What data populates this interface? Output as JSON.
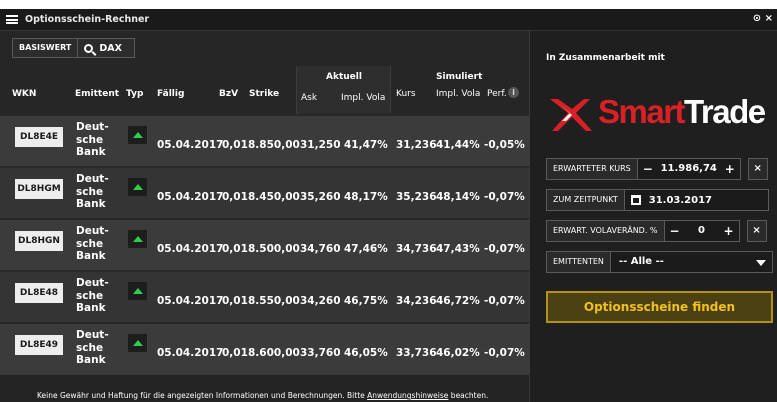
{
  "window": {
    "title": "Optionsschein-Rechner",
    "controls": "⊙ ×"
  },
  "search": {
    "basiswert_label": "BASISWERT",
    "underlying": "DAX"
  },
  "table": {
    "headers": {
      "wkn": "WKN",
      "emittent": "Emittent",
      "typ": "Typ",
      "faellig": "Fällig",
      "bzv": "BzV",
      "strike": "Strike",
      "aktuell": "Aktuell",
      "ask": "Ask",
      "impl_vola_aktuell": "Impl. Vola",
      "simuliert": "Simuliert",
      "kurs": "Kurs",
      "impl_vola_sim": "Impl. Vola",
      "perf": "Perf.",
      "info": "i"
    },
    "rows": [
      {
        "wkn": "DL8E4E",
        "emittent_lines": [
          "Deut-",
          "sche",
          "Bank"
        ],
        "typ": "call-up-icon",
        "faellig": "05.04.2017",
        "bzv": "0,01",
        "strike": "8.850,00",
        "ask": "31,250",
        "impl_vola": "41,47%",
        "kurs": "31,236",
        "impl_vola_sim": "41,44%",
        "perf": "-0,05%"
      },
      {
        "wkn": "DL8HGM",
        "emittent_lines": [
          "Deut-",
          "sche",
          "Bank"
        ],
        "typ": "call-up-icon",
        "faellig": "05.04.2017",
        "bzv": "0,01",
        "strike": "8.450,00",
        "ask": "35,260",
        "impl_vola": "48,17%",
        "kurs": "35,236",
        "impl_vola_sim": "48,14%",
        "perf": "-0,07%"
      },
      {
        "wkn": "DL8HGN",
        "emittent_lines": [
          "Deut-",
          "sche",
          "Bank"
        ],
        "typ": "call-up-icon",
        "faellig": "05.04.2017",
        "bzv": "0,01",
        "strike": "8.500,00",
        "ask": "34,760",
        "impl_vola": "47,46%",
        "kurs": "34,736",
        "impl_vola_sim": "47,43%",
        "perf": "-0,07%"
      },
      {
        "wkn": "DL8E48",
        "emittent_lines": [
          "Deut-",
          "sche",
          "Bank"
        ],
        "typ": "call-up-icon",
        "faellig": "05.04.2017",
        "bzv": "0,01",
        "strike": "8.550,00",
        "ask": "34,260",
        "impl_vola": "46,75%",
        "kurs": "34,236",
        "impl_vola_sim": "46,72%",
        "perf": "-0,07%"
      },
      {
        "wkn": "DL8E49",
        "emittent_lines": [
          "Deut-",
          "sche",
          "Bank"
        ],
        "typ": "call-up-icon",
        "faellig": "05.04.2017",
        "bzv": "0,01",
        "strike": "8.600,00",
        "ask": "33,760",
        "impl_vola": "46,05%",
        "kurs": "33,736",
        "impl_vola_sim": "46,02%",
        "perf": "-0,07%"
      }
    ]
  },
  "footer": {
    "text_before": "Keine Gewähr und Haftung für die angezeigten Informationen und Berechnungen. Bitte ",
    "link": "Anwendungshinweise",
    "text_after": " beachten."
  },
  "sidebar": {
    "partner_label": "In Zusammenarbeit mit",
    "logo": {
      "smart": "Smart",
      "trade": "Trade",
      "icon": "smarttrade-logo-icon"
    },
    "erwarteter_kurs": {
      "label": "ERWARTETER KURS",
      "minus": "−",
      "value": "11.986,74",
      "plus": "+",
      "clear": "×"
    },
    "zeitpunkt": {
      "label": "ZUM ZEITPUNKT",
      "value": "31.03.2017",
      "icon": "calendar-icon"
    },
    "vola": {
      "label": "ERWART. VOLAVERÄND. %",
      "minus": "−",
      "value": "0",
      "plus": "+",
      "clear": "×"
    },
    "emittenten": {
      "label": "EMITTENTEN",
      "value": "-- Alle --"
    },
    "find_button": "Optionsscheine finden"
  },
  "colors": {
    "accent_yellow": "#f2c11e",
    "logo_red": "#d92027",
    "call_green": "#2fcf4a"
  }
}
